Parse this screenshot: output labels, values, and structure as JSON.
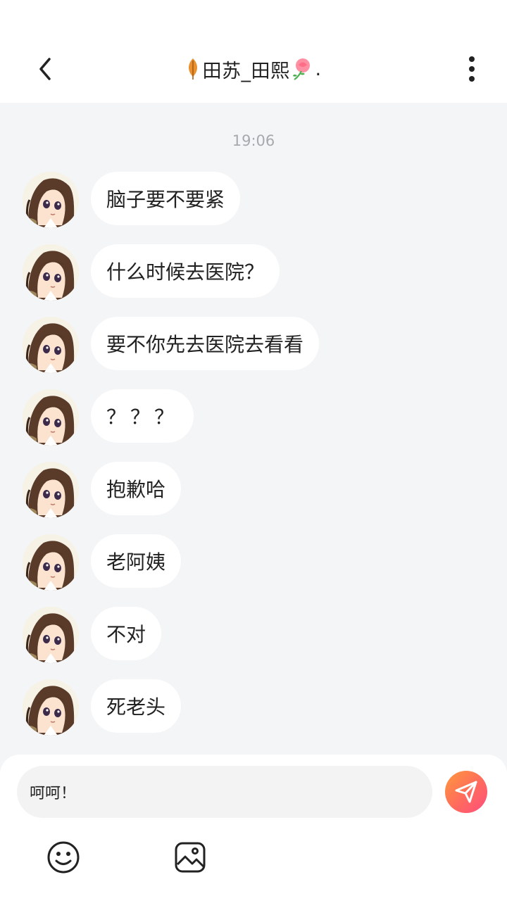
{
  "header": {
    "title": "田苏_田熙",
    "title_suffix": ".",
    "back_icon": "chevron-left-icon",
    "more_icon": "more-vertical-icon"
  },
  "chat": {
    "timestamp": "19:06",
    "messages": [
      {
        "text": "脑子要不要紧"
      },
      {
        "text": "什么时候去医院？"
      },
      {
        "text": "要不你先去医院去看看"
      },
      {
        "text": "？？？"
      },
      {
        "text": "抱歉哈"
      },
      {
        "text": "老阿姨"
      },
      {
        "text": "不对"
      },
      {
        "text": "死老头"
      }
    ]
  },
  "composer": {
    "input_value": "呵呵！",
    "send_icon": "send-icon",
    "emoji_icon": "emoji-icon",
    "image_icon": "image-icon"
  },
  "colors": {
    "background": "#f4f5f7",
    "bubble": "#ffffff",
    "send_gradient_start": "#ff9a3c",
    "send_gradient_end": "#ff4d7e"
  }
}
